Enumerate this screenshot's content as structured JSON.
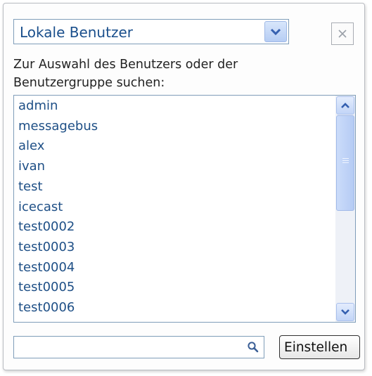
{
  "select": {
    "value": "Lokale Benutzer"
  },
  "close_label": "x",
  "hint": "Zur Auswahl des Benutzers oder der Benutzergruppe suchen:",
  "users": [
    "admin",
    "messagebus",
    "alex",
    "ivan",
    "test",
    "icecast",
    "test0002",
    "test0003",
    "test0004",
    "test0005",
    "test0006"
  ],
  "search": {
    "value": "",
    "placeholder": ""
  },
  "apply_label": "Einstellen"
}
